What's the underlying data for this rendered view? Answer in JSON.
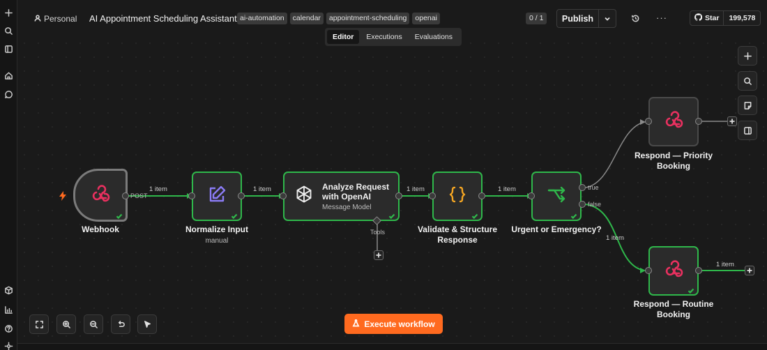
{
  "header": {
    "project": "Personal",
    "title": "AI Appointment Scheduling Assistant",
    "tags": [
      "ai-automation",
      "calendar",
      "appointment-scheduling",
      "openai"
    ],
    "counter": "0 / 1",
    "publish_label": "Publish",
    "more_label": "···",
    "star_label": "Star",
    "star_count": "199,578"
  },
  "tabs": [
    {
      "label": "Editor",
      "active": true
    },
    {
      "label": "Executions",
      "active": false
    },
    {
      "label": "Evaluations",
      "active": false
    }
  ],
  "nodes": {
    "webhook": {
      "label": "Webhook",
      "port_label": "POST"
    },
    "normalize": {
      "label": "Normalize Input",
      "sub": "manual"
    },
    "openai": {
      "title": "Analyze Request with OpenAI",
      "sub": "Message Model",
      "port_label": "Tools"
    },
    "validate": {
      "label": "Validate & Structure Response"
    },
    "urgent": {
      "label": "Urgent or Emergency?",
      "true_label": "true",
      "false_label": "false"
    },
    "priority": {
      "label": "Respond — Priority Booking"
    },
    "routine": {
      "label": "Respond — Routine Booking"
    }
  },
  "edges": {
    "webhook_to_normalize": "1 item",
    "normalize_to_openai": "1 item",
    "openai_to_validate": "1 item",
    "validate_to_urgent": "1 item",
    "urgent_false_to_routine": "1 item",
    "routine_out": "1 item"
  },
  "execute_label": "Execute workflow",
  "colors": {
    "success": "#2fb84b",
    "accent": "#ff6a1f",
    "webhook_icon": "#e8305f",
    "edit_icon": "#8b7cf6",
    "braces_icon": "#f5a623"
  },
  "icons": {
    "sidebar": [
      "plus-icon",
      "search-icon",
      "panel-icon",
      "home-icon",
      "chat-icon",
      "templates-icon",
      "insights-icon",
      "help-icon"
    ],
    "right_toolbar": [
      "plus-icon",
      "search-icon",
      "sticky-note-icon",
      "panel-icon"
    ],
    "bottom_toolbar": [
      "fit-view-icon",
      "zoom-in-icon",
      "zoom-out-icon",
      "undo-icon",
      "cursor-icon"
    ]
  }
}
